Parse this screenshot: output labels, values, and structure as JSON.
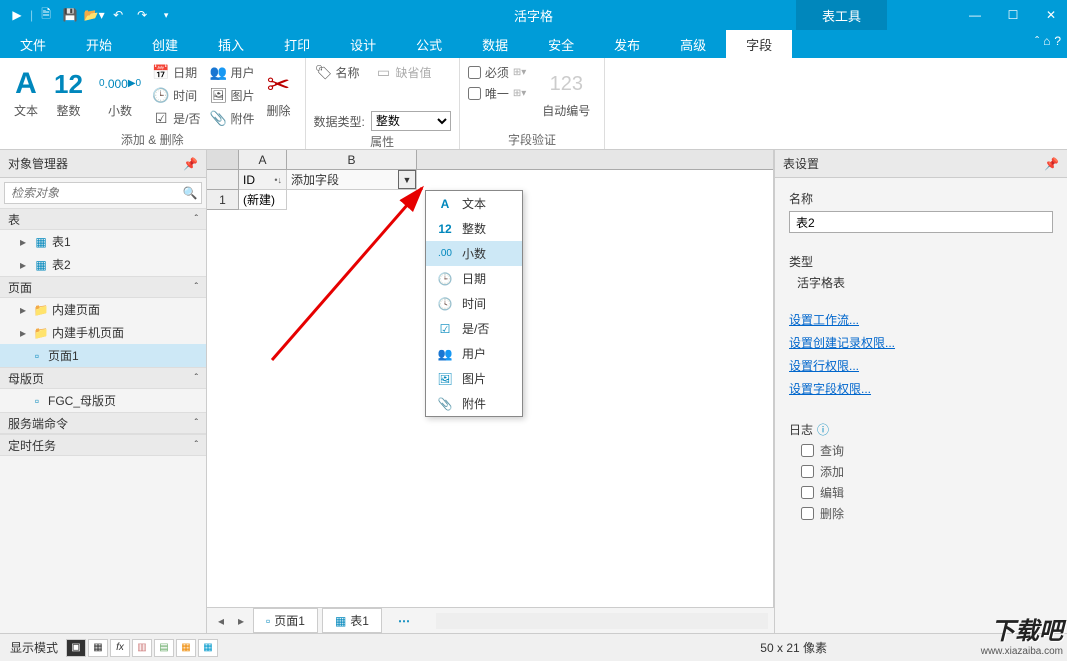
{
  "titlebar": {
    "app_title": "活字格",
    "tools_tab": "表工具"
  },
  "menubar": {
    "items": [
      "文件",
      "开始",
      "创建",
      "插入",
      "打印",
      "设计",
      "公式",
      "数据",
      "安全",
      "发布",
      "高级",
      "字段"
    ],
    "active": 11
  },
  "ribbon": {
    "group1": {
      "big": [
        {
          "label": "文本",
          "color": "#0087bc",
          "glyph": "A"
        },
        {
          "label": "整数",
          "color": "#0087bc",
          "glyph": "12"
        },
        {
          "label": "小数",
          "color": "#0087bc",
          "glyph": ".000"
        }
      ],
      "mini": [
        {
          "label": "日期",
          "icon": "📅"
        },
        {
          "label": "用户",
          "icon": "👥"
        },
        {
          "label": "时间",
          "icon": "🕒"
        },
        {
          "label": "图片",
          "icon": "🖼"
        },
        {
          "label": "是/否",
          "icon": "☑"
        },
        {
          "label": "附件",
          "icon": "📎"
        }
      ],
      "delete": "删除",
      "title": "添加 & 删除"
    },
    "group2": {
      "rows": [
        {
          "label": "名称",
          "icon": "🏷"
        },
        {
          "label": "缺省值",
          "icon": "▭"
        }
      ],
      "type_label": "数据类型:",
      "type_value": "整数",
      "title": "属性"
    },
    "group3": {
      "chk1": "必须",
      "chk2": "唯一",
      "auto": "自动编号",
      "title": "字段验证"
    }
  },
  "left": {
    "title": "对象管理器",
    "search_placeholder": "检索对象",
    "sec_table": "表",
    "tables": [
      "表1",
      "表2"
    ],
    "sec_page": "页面",
    "pages_folders": [
      "内建页面",
      "内建手机页面"
    ],
    "page_leaf": "页面1",
    "sec_master": "母版页",
    "master_leaf": "FGC_母版页",
    "sec_cmd": "服务端命令",
    "sec_task": "定时任务"
  },
  "grid": {
    "colA": "A",
    "colB": "B",
    "id_label": "ID",
    "add_field": "添加字段",
    "row1": "1",
    "row1_val": "(新建)"
  },
  "dropdown": {
    "items": [
      {
        "label": "文本",
        "icon": "A",
        "color": "#0087bc"
      },
      {
        "label": "整数",
        "icon": "12",
        "color": "#0087bc"
      },
      {
        "label": "小数",
        "icon": ".00",
        "color": "#0087bc",
        "hover": true
      },
      {
        "label": "日期",
        "icon": "🕒"
      },
      {
        "label": "时间",
        "icon": "🕓"
      },
      {
        "label": "是/否",
        "icon": "☑"
      },
      {
        "label": "用户",
        "icon": "👥"
      },
      {
        "label": "图片",
        "icon": "🖼"
      },
      {
        "label": "附件",
        "icon": "📎"
      }
    ]
  },
  "sheets": {
    "tab1": "页面1",
    "tab2": "表1"
  },
  "right": {
    "title": "表设置",
    "name_label": "名称",
    "name_value": "表2",
    "type_label": "类型",
    "type_value": "活字格表",
    "links": [
      "设置工作流...",
      "设置创建记录权限...",
      "设置行权限...",
      "设置字段权限..."
    ],
    "log_label": "日志",
    "log_opts": [
      "查询",
      "添加",
      "编辑",
      "删除"
    ]
  },
  "status": {
    "mode_label": "显示模式",
    "pixels": "50 x 21 像素"
  },
  "watermark": {
    "line1": "下载吧",
    "line2": "www.xiazaiba.com"
  }
}
